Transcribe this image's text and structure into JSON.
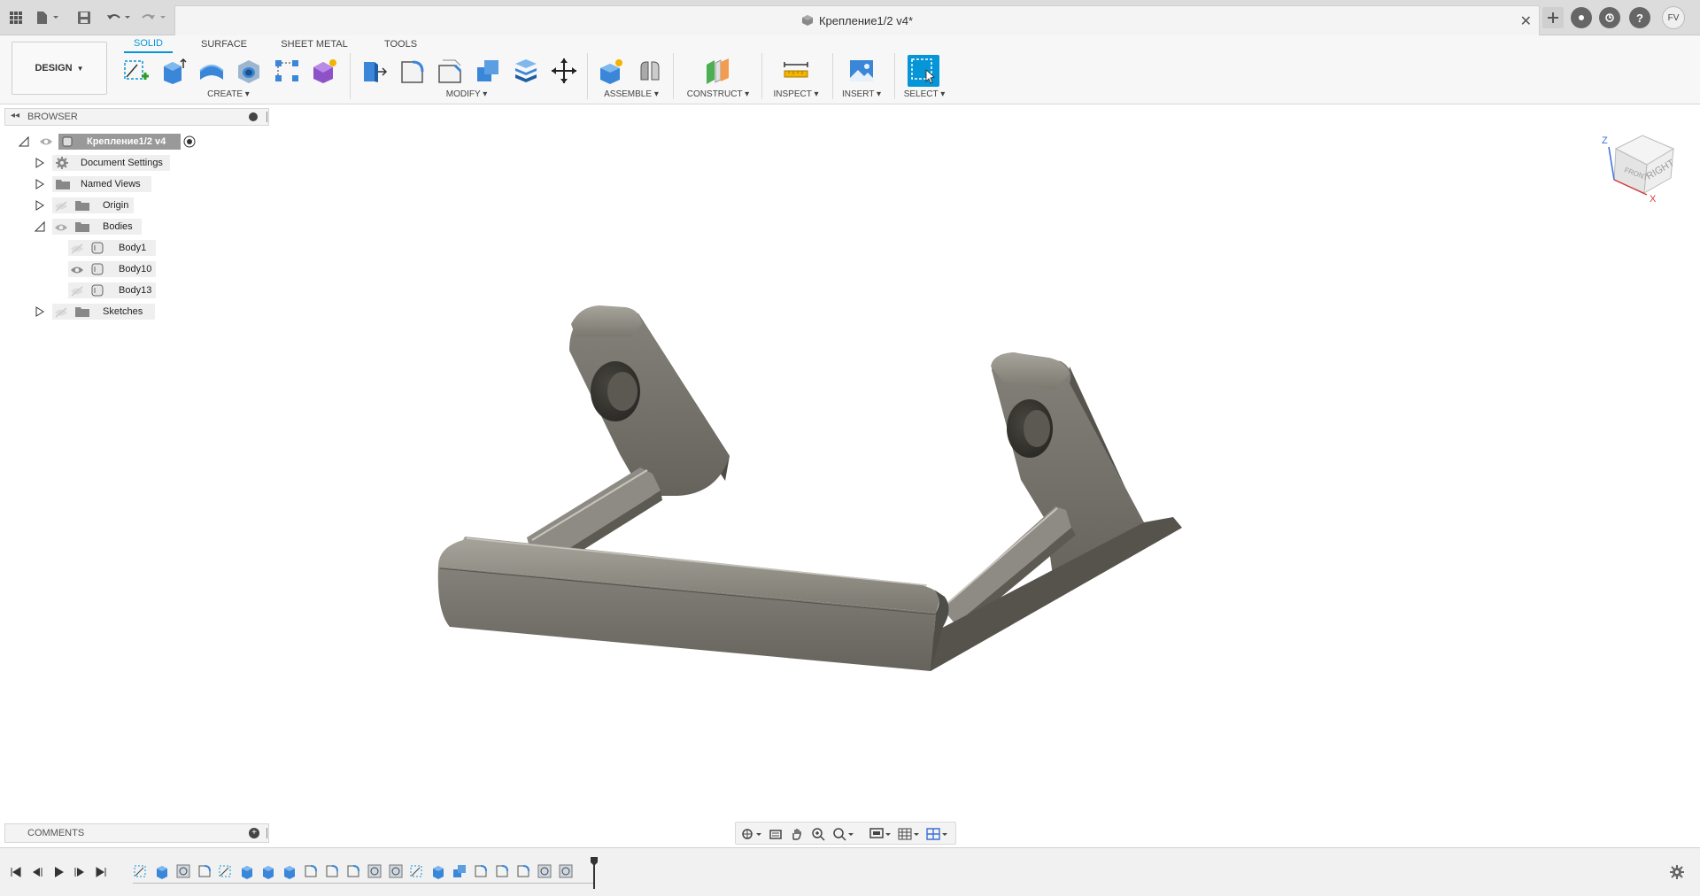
{
  "window": {
    "title": "Крепление1/2 v4*",
    "user_initials": "FV"
  },
  "toolbar": {
    "workspace": "DESIGN",
    "tabs": [
      "SOLID",
      "SURFACE",
      "SHEET METAL",
      "TOOLS"
    ],
    "active_tab": "SOLID",
    "groups": {
      "create": "CREATE",
      "modify": "MODIFY",
      "assemble": "ASSEMBLE",
      "construct": "CONSTRUCT",
      "inspect": "INSPECT",
      "insert": "INSERT",
      "select": "SELECT"
    }
  },
  "browser": {
    "header": "BROWSER",
    "root": "Крепление1/2 v4",
    "items": [
      "Document Settings",
      "Named Views",
      "Origin",
      "Bodies",
      "Sketches"
    ],
    "bodies": [
      "Body1",
      "Body10",
      "Body13"
    ]
  },
  "comments": {
    "label": "COMMENTS"
  },
  "viewcube": {
    "face_right": "RIGHT",
    "face_front": "FRONT",
    "axis_z": "Z",
    "axis_x": "X"
  },
  "colors": {
    "accent": "#0696d7",
    "model": "#76736b"
  }
}
